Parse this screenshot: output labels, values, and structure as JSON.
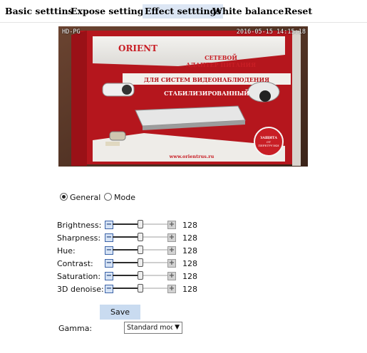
{
  "tabs": [
    {
      "label": "Basic setttins",
      "active": false
    },
    {
      "label": "Expose settings",
      "active": false
    },
    {
      "label": "Effect setttings",
      "active": true
    },
    {
      "label": "White balance",
      "active": false
    },
    {
      "label": "Reset",
      "active": false
    }
  ],
  "preview": {
    "osd_left": "HD-PG",
    "osd_right": "2016-05-15 14:15:18",
    "box": {
      "brand": "ORIENT",
      "line1": "СЕТЕВОЙ",
      "line2": "АДАПТЕР ПИТАНИЯ",
      "line3": "ДЛЯ СИСТЕМ ВИДЕОНАБЛЮДЕНИЯ",
      "line4": "СТАБИЛИЗИРОВАННЫЙ",
      "badge1": "ЗАЩИТА",
      "badge2": "ОТ",
      "badge3": "ПЕРЕГРУЗКИ",
      "url": "www.orientrus.ru"
    }
  },
  "mode": {
    "options": [
      {
        "label": "General",
        "selected": true
      },
      {
        "label": "Mode",
        "selected": false
      }
    ]
  },
  "sliders": [
    {
      "label": "Brightness:",
      "value": "128",
      "fraction": 0.5
    },
    {
      "label": "Sharpness:",
      "value": "128",
      "fraction": 0.5
    },
    {
      "label": "Hue:",
      "value": "128",
      "fraction": 0.5
    },
    {
      "label": "Contrast:",
      "value": "128",
      "fraction": 0.5
    },
    {
      "label": "Saturation:",
      "value": "128",
      "fraction": 0.5
    },
    {
      "label": "3D denoise:",
      "value": "128",
      "fraction": 0.5
    }
  ],
  "controls": {
    "minus_symbol": "−",
    "plus_symbol": "+",
    "save_label": "Save",
    "gamma_label": "Gamma:",
    "gamma_value": "Standard mod",
    "gamma_arrow": "▼"
  },
  "colors": {
    "active_tab_bg": "#dce6f4",
    "save_bg": "#c9dbf0",
    "box_red": "#c81e25"
  }
}
